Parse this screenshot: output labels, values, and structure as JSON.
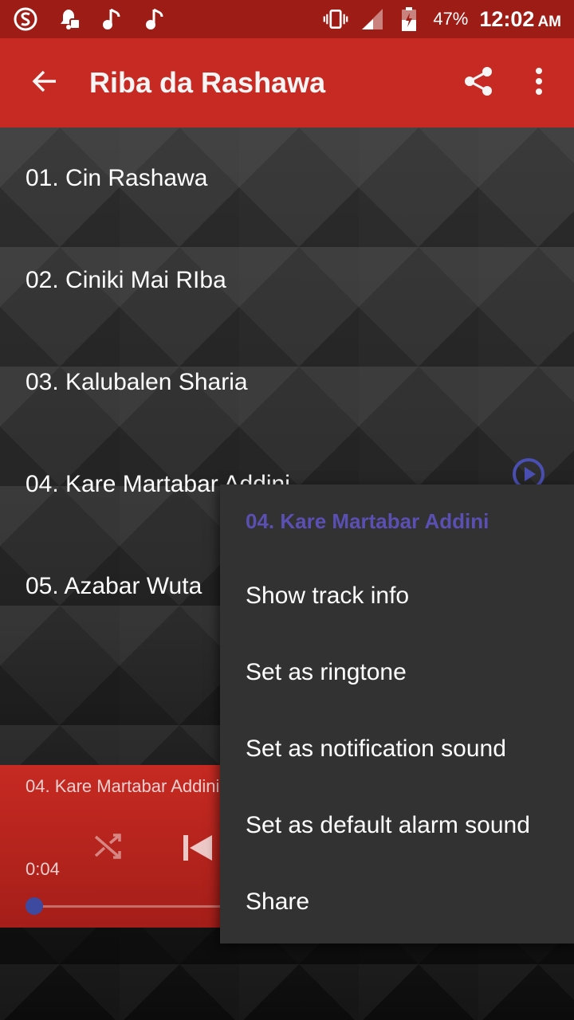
{
  "status_bar": {
    "battery": "47%",
    "time": "12:02",
    "ampm": "AM"
  },
  "app_bar": {
    "title": "Riba da Rashawa"
  },
  "tracks": [
    {
      "label": "01. Cin Rashawa"
    },
    {
      "label": "02. Ciniki Mai RIba"
    },
    {
      "label": "03. Kalubalen Sharia"
    },
    {
      "label": "04. Kare Martabar Addini"
    },
    {
      "label": "05. Azabar Wuta"
    }
  ],
  "player": {
    "now_playing": "04. Kare Martabar Addini",
    "current_time": "0:04"
  },
  "context_menu": {
    "title": "04. Kare Martabar Addini",
    "items": [
      {
        "label": "Show track info"
      },
      {
        "label": "Set as ringtone"
      },
      {
        "label": "Set as notification sound"
      },
      {
        "label": "Set as default alarm sound"
      },
      {
        "label": "Share"
      }
    ]
  },
  "colors": {
    "status_bar": "#9e1c16",
    "app_bar": "#c62a22",
    "menu_bg": "#323232",
    "menu_title": "#5a4fb3",
    "seek_thumb": "#3d4aa0"
  },
  "icons": {
    "status_left": [
      "s-app-icon",
      "notification-bell-icon",
      "music-note-icon",
      "music-note-icon"
    ],
    "status_right": [
      "vibrate-icon",
      "signal-icon",
      "battery-icon"
    ],
    "app_bar": [
      "back-arrow-icon",
      "share-icon",
      "more-vert-icon"
    ]
  }
}
